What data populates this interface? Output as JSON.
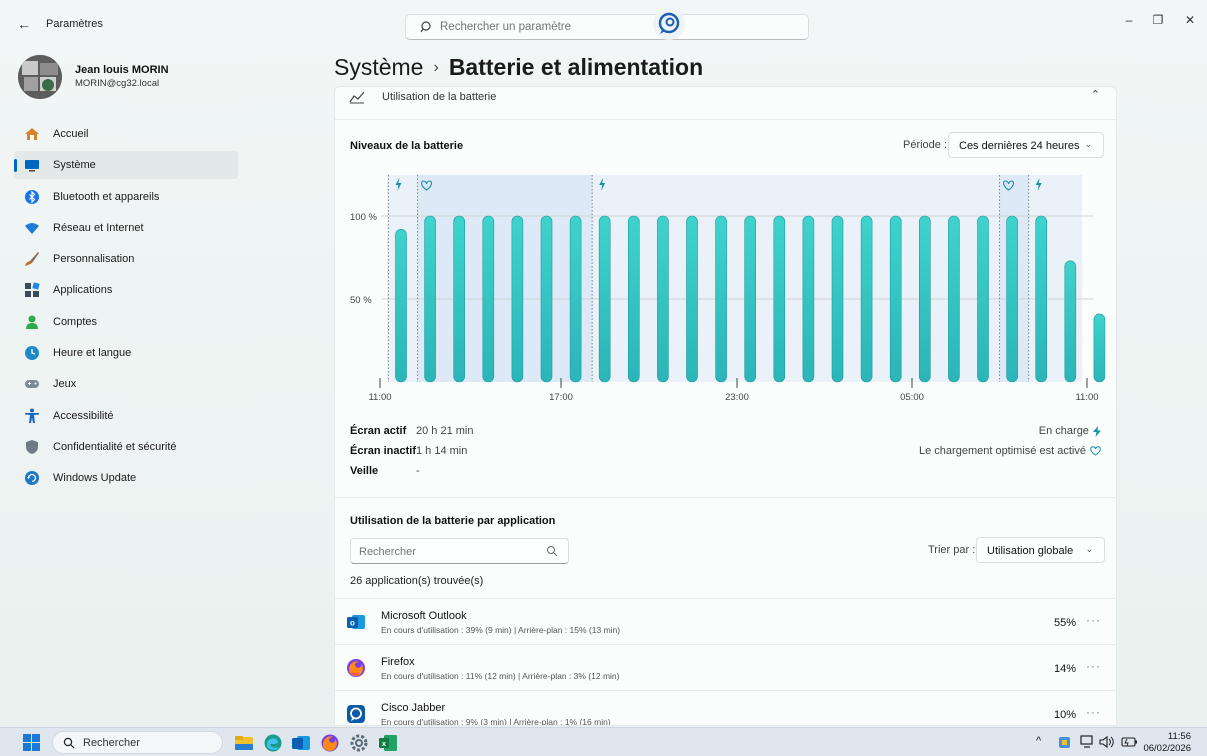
{
  "window": {
    "back_glyph": "←",
    "title": "Paramètres",
    "search_placeholder": "Rechercher un paramètre",
    "controls": {
      "minimize": "–",
      "restore": "❐",
      "close": "✕"
    }
  },
  "profile": {
    "name": "Jean louis MORIN",
    "email": "MORIN@cg32.local"
  },
  "sidebar": {
    "items": [
      {
        "label": "Accueil",
        "icon": "home-icon",
        "color": "#d9822b"
      },
      {
        "label": "Système",
        "icon": "monitor-icon",
        "color": "#0067c0",
        "active": true
      },
      {
        "label": "Bluetooth et appareils",
        "icon": "bluetooth-icon",
        "color": "#1a73e8"
      },
      {
        "label": "Réseau et Internet",
        "icon": "wifi-icon",
        "color": "#1f7bd6"
      },
      {
        "label": "Personnalisation",
        "icon": "brush-icon",
        "color": "#c46a2a"
      },
      {
        "label": "Applications",
        "icon": "apps-icon",
        "color": "#3a4a5a"
      },
      {
        "label": "Comptes",
        "icon": "person-icon",
        "color": "#2ea94b"
      },
      {
        "label": "Heure et langue",
        "icon": "globe-clock-icon",
        "color": "#1e88c8"
      },
      {
        "label": "Jeux",
        "icon": "gamepad-icon",
        "color": "#7d8a96"
      },
      {
        "label": "Accessibilité",
        "icon": "accessibility-icon",
        "color": "#1769c4"
      },
      {
        "label": "Confidentialité et sécurité",
        "icon": "shield-icon",
        "color": "#6f7a84"
      },
      {
        "label": "Windows Update",
        "icon": "update-icon",
        "color": "#1d78c8"
      }
    ]
  },
  "header": {
    "section": "Système",
    "separator": "›",
    "page": "Batterie et alimentation"
  },
  "battery_usage": {
    "section_title": "Utilisation de la batterie",
    "levels_title": "Niveaux de la batterie",
    "period_label": "Période :",
    "period_value": "Ces dernières 24 heures",
    "stats": [
      {
        "label": "Écran actif",
        "value": "20 h 21 min"
      },
      {
        "label": "Écran inactif",
        "value": "1 h 14 min"
      },
      {
        "label": "Veille",
        "value": "-"
      }
    ],
    "legend": {
      "charging": "En charge",
      "optimized": "Le chargement optimisé est activé"
    }
  },
  "chart_data": {
    "type": "bar",
    "title": "Niveaux de la batterie",
    "y_ticks": [
      "100 %",
      "50 %"
    ],
    "ylim": [
      0,
      100
    ],
    "x_ticks": [
      "11:00",
      "17:00",
      "23:00",
      "05:00",
      "11:00"
    ],
    "values": [
      92,
      100,
      100,
      100,
      100,
      100,
      100,
      100,
      100,
      100,
      100,
      100,
      100,
      100,
      100,
      100,
      100,
      100,
      100,
      100,
      100,
      100,
      100,
      73,
      41
    ],
    "charging_markers": [
      0,
      7,
      22
    ],
    "optimized_markers": [
      1,
      21
    ],
    "colors": {
      "bar": "#2bb5b8",
      "bar_top": "#3fd3cc",
      "shade": "#dde9f6"
    }
  },
  "app_usage": {
    "title": "Utilisation de la batterie par application",
    "search_placeholder": "Rechercher",
    "sort_label": "Trier par :",
    "sort_value": "Utilisation globale",
    "count_text": "26 application(s) trouvée(s)",
    "apps": [
      {
        "name": "Microsoft Outlook",
        "detail": "En cours d'utilisation : 39% (9 min) | Arrière-plan : 15% (13 min)",
        "percent": "55%",
        "icon": "outlook-icon"
      },
      {
        "name": "Firefox",
        "detail": "En cours d'utilisation : 11% (12 min) | Arrière-plan : 3% (12 min)",
        "percent": "14%",
        "icon": "firefox-icon"
      },
      {
        "name": "Cisco Jabber",
        "detail": "En cours d'utilisation : 9% (3 min) | Arrière-plan : 1% (16 min)",
        "percent": "10%",
        "icon": "jabber-icon"
      }
    ],
    "more_glyph": "···"
  },
  "taskbar": {
    "search_text": "Rechercher",
    "apps": [
      "file-explorer-icon",
      "edge-icon",
      "outlook-icon",
      "firefox-icon",
      "settings-icon",
      "excel-icon"
    ],
    "tray_chevron": "^",
    "time": "11:56",
    "date": "06/02/2026"
  }
}
